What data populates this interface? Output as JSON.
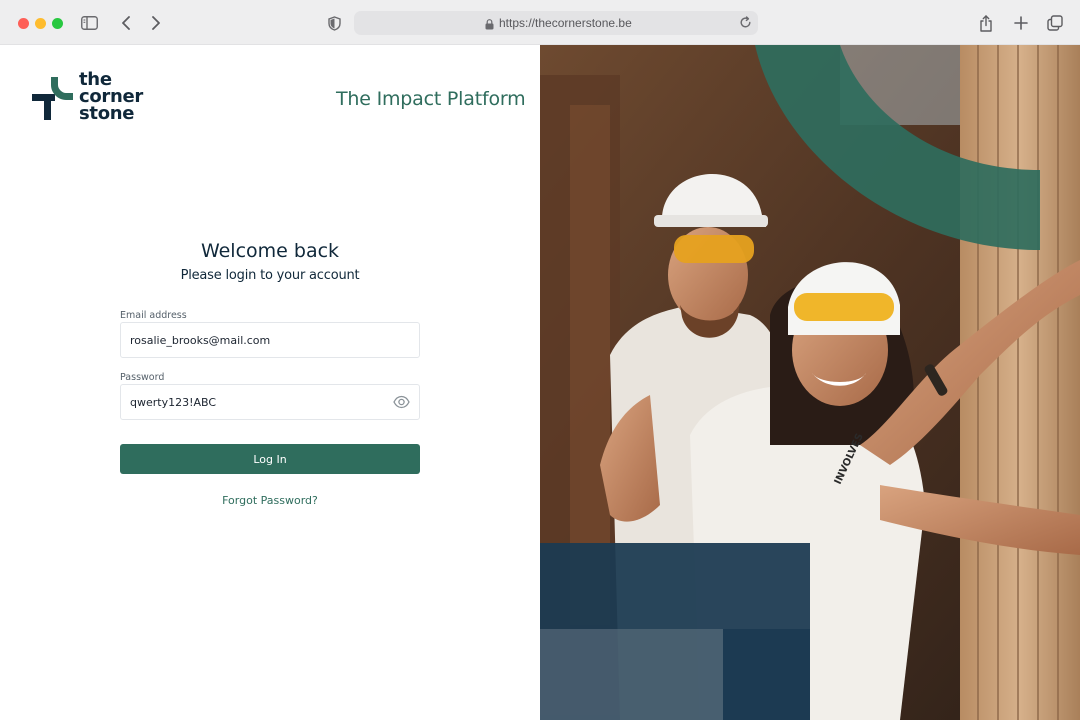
{
  "browser": {
    "url": "https://thecornerstone.be",
    "icons": [
      "sidebar-icon",
      "back-icon",
      "forward-icon",
      "shield-icon",
      "lock-icon",
      "reload-icon",
      "share-icon",
      "new-tab-icon",
      "tabs-overview-icon"
    ]
  },
  "brand": {
    "logo_line1": "the",
    "logo_line2": "corner",
    "logo_line3": "stone",
    "tagline": "The Impact Platform",
    "colors": {
      "primary": "#2f6d5d",
      "navy": "#10283a",
      "hero_navy": "#1c3a52"
    }
  },
  "login": {
    "title": "Welcome back",
    "subtitle": "Please login to your account",
    "email_label": "Email address",
    "email_value": "rosalie_brooks@mail.com",
    "password_label": "Password",
    "password_value": "qwerty123!ABC",
    "login_button": "Log In",
    "forgot_link": "Forgot Password?"
  },
  "hero": {
    "shirt_text": "INVOLVES"
  }
}
